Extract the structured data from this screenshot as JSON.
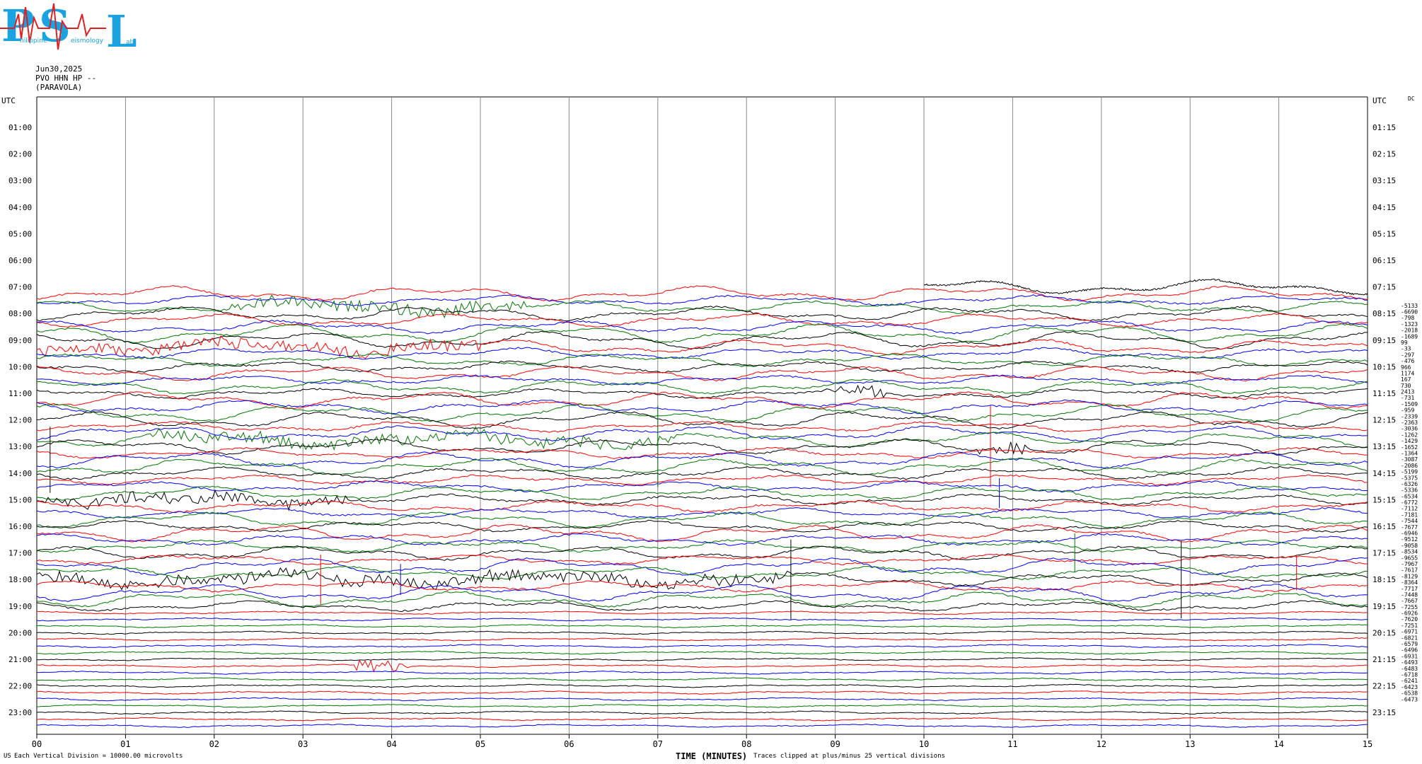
{
  "header": {
    "logo_text": "PSL",
    "logo_subtext": "Philippine Seismology Lab",
    "date": "Jun30,2025",
    "station": "PVO HHN HP --",
    "location": "(PARAVOLA)",
    "utc_left": "UTC",
    "utc_right": "UTC",
    "dc_label": "DC"
  },
  "footer": {
    "scale_note": "Each Vertical Division = 10000.00 microvolts",
    "xlabel": "TIME (MINUTES)",
    "clip_note": "Traces clipped at plus/minus 25 vertical divisions",
    "corner_mark": "US"
  },
  "colors": {
    "trace_cycle": [
      "#000000",
      "#ff0000",
      "#0000ff",
      "#007700"
    ],
    "grid": "#888888"
  },
  "chart_data": {
    "type": "line",
    "title": "",
    "xlabel": "TIME (MINUTES)",
    "ylabel": "UTC",
    "x_ticks": [
      "00",
      "01",
      "02",
      "03",
      "04",
      "05",
      "06",
      "07",
      "08",
      "09",
      "10",
      "11",
      "12",
      "13",
      "14",
      "15"
    ],
    "xlim": [
      0,
      15
    ],
    "grid": "vertical lines at each minute",
    "left_hour_labels": [
      "01:00",
      "02:00",
      "03:00",
      "04:00",
      "05:00",
      "06:00",
      "07:00",
      "08:00",
      "09:00",
      "10:00",
      "11:00",
      "12:00",
      "13:00",
      "14:00",
      "15:00",
      "16:00",
      "17:00",
      "18:00",
      "19:00",
      "20:00",
      "21:00",
      "22:00",
      "23:00"
    ],
    "right_hour_labels": [
      "01:15",
      "02:15",
      "03:15",
      "04:15",
      "05:15",
      "06:15",
      "07:15",
      "08:15",
      "09:15",
      "10:15",
      "11:15",
      "12:15",
      "13:15",
      "14:15",
      "15:15",
      "16:15",
      "17:15",
      "18:15",
      "19:15",
      "20:15",
      "21:15",
      "22:15",
      "23:15"
    ],
    "traces_start": "07:00 (partial from minute 10)",
    "dc_offsets": [
      "-5133",
      "-6690",
      "-798",
      "-1323",
      "-2018",
      "-1689",
      "99",
      "-33",
      "-297",
      "-476",
      "966",
      "1174",
      "167",
      "730",
      "2413",
      "-731",
      "-1509",
      "-959",
      "-2339",
      "-2363",
      "-3036",
      "-1262",
      "-1429",
      "-1652",
      "-1364",
      "-3087",
      "-2086",
      "-5199",
      "-5375",
      "-6326",
      "-5336",
      "-6534",
      "-6772",
      "-7112",
      "-7181",
      "-7544",
      "-7677",
      "-6946",
      "-9512",
      "-9058",
      "-8534",
      "-9655",
      "-7967",
      "-7617",
      "-8129",
      "-8364",
      "-7717",
      "-7448",
      "-7667",
      "-7255",
      "-6926",
      "-7620",
      "-7251",
      "-6971",
      "-6821",
      "-6579",
      "-6496",
      "-6931",
      "-6493",
      "-6483",
      "-6718",
      "-6241",
      "-6423",
      "-6538",
      "-6473"
    ],
    "active_events": [
      {
        "row_time": "07:45",
        "minute_from": 2.2,
        "minute_to": 5.5
      },
      {
        "row_time": "09:15",
        "minute_from": 0.0,
        "minute_to": 5.0
      },
      {
        "row_time": "11:00",
        "minute_from": 8.9,
        "minute_to": 9.6
      },
      {
        "row_time": "12:45",
        "minute_from": 1.3,
        "minute_to": 7.2
      },
      {
        "row_time": "13:00",
        "minute_from": 10.6,
        "minute_to": 11.2
      },
      {
        "row_time": "15:00",
        "minute_from": 0.1,
        "minute_to": 3.5
      },
      {
        "row_time": "18:00",
        "minute_from": 0.0,
        "minute_to": 8.5
      },
      {
        "row_time": "21:15",
        "minute_from": 3.6,
        "minute_to": 4.2
      }
    ]
  }
}
